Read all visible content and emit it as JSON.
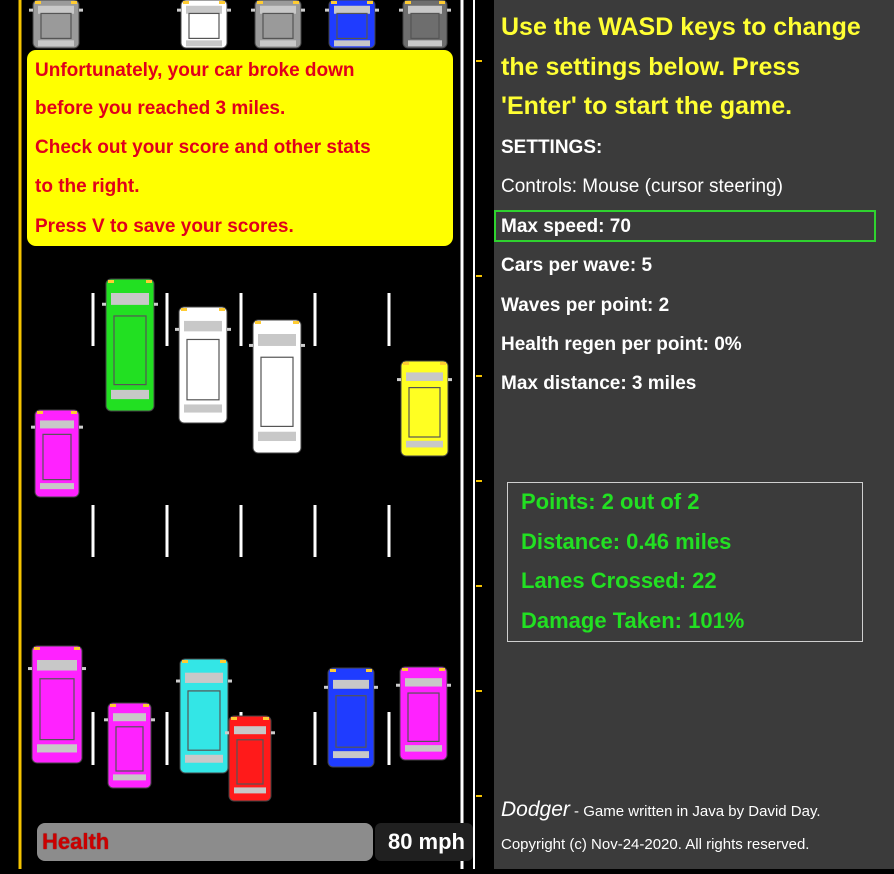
{
  "message": {
    "lines": [
      "Unfortunately, your car broke down",
      "before you reached 3 miles.",
      "Check out your score and other stats",
      "to the right.",
      "Press V to save your scores."
    ]
  },
  "hud": {
    "health_label": "Health",
    "health_fraction": 0.0,
    "speed": "80 mph"
  },
  "panel": {
    "intro": [
      "Use the WASD keys to change",
      "the settings below. Press",
      "'Enter' to start the game."
    ],
    "settings_heading": "SETTINGS:",
    "settings": [
      "Controls: Mouse (cursor steering)",
      "Max speed: 70",
      "Cars per wave: 5",
      "Waves per point: 2",
      "Health regen per point: 0%",
      "Max distance: 3 miles"
    ],
    "selected_setting": "Max speed: 70",
    "stats": [
      "Points: 2 out of 2",
      "Distance: 0.46 miles",
      "Lanes Crossed: 22",
      "Damage Taken: 101%"
    ],
    "credits_brand": "Dodger",
    "credits_text": " - Game written in Java by David Day.",
    "copyright": "Copyright (c) Nov-24-2020. All rights reserved."
  },
  "colors": {
    "road": "#000000",
    "panel": "#3b3b3b",
    "message_bg": "#ffff00",
    "message_text": "#e0001b",
    "intro_text": "#ffff33",
    "stat_text": "#22e022",
    "selection": "#2fd22f",
    "edge_line": "#f5c400"
  },
  "cars": [
    {
      "name": "car-gray-top-1",
      "color": "#9a9a9a",
      "kind": "car"
    },
    {
      "name": "car-white-top",
      "color": "#ffffff",
      "kind": "car"
    },
    {
      "name": "car-gray-top-2",
      "color": "#9a9a9a",
      "kind": "car"
    },
    {
      "name": "car-blue-top",
      "color": "#1f3cff",
      "kind": "car"
    },
    {
      "name": "car-dark-top",
      "color": "#6e6e6e",
      "kind": "car"
    },
    {
      "name": "truck-green",
      "color": "#22e022",
      "kind": "truck"
    },
    {
      "name": "van-white",
      "color": "#ffffff",
      "kind": "van"
    },
    {
      "name": "truck-white",
      "color": "#ffffff",
      "kind": "truck"
    },
    {
      "name": "car-yellow",
      "color": "#ffff22",
      "kind": "car"
    },
    {
      "name": "car-magenta-left",
      "color": "#ff22ff",
      "kind": "car"
    },
    {
      "name": "van-magenta",
      "color": "#ff22ff",
      "kind": "van"
    },
    {
      "name": "car-magenta-small",
      "color": "#ff22ff",
      "kind": "car"
    },
    {
      "name": "van-cyan",
      "color": "#33e6e6",
      "kind": "van"
    },
    {
      "name": "car-red",
      "color": "#ff1a1a",
      "kind": "car"
    },
    {
      "name": "car-blue",
      "color": "#1f3cff",
      "kind": "car"
    },
    {
      "name": "car-magenta-right",
      "color": "#ff22ff",
      "kind": "car"
    }
  ]
}
